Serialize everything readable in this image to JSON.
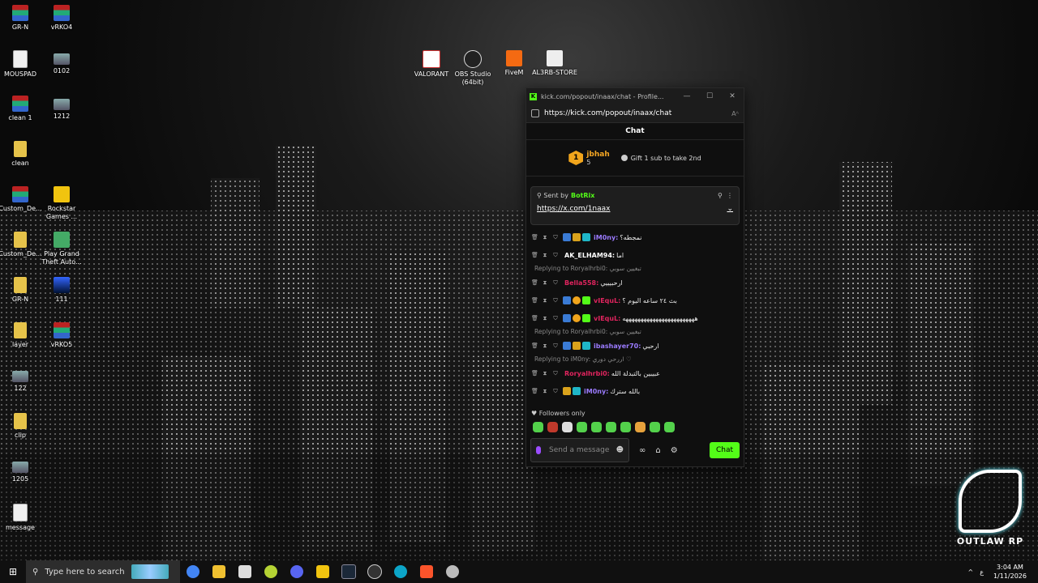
{
  "desktop": {
    "icons": [
      {
        "label": "GR-N"
      },
      {
        "label": "vRKO4"
      },
      {
        "label": "MOUSPAD"
      },
      {
        "label": "0102"
      },
      {
        "label": "clean 1"
      },
      {
        "label": "1212"
      },
      {
        "label": "clean"
      },
      {
        "label": "Custom_De..."
      },
      {
        "label": "Rockstar Games ..."
      },
      {
        "label": "Custom_De..."
      },
      {
        "label": "Play Grand Theft Auto..."
      },
      {
        "label": "GR-N"
      },
      {
        "label": "111"
      },
      {
        "label": "layer"
      },
      {
        "label": "vRKO5"
      },
      {
        "label": "122"
      },
      {
        "label": "clip"
      },
      {
        "label": "1205"
      },
      {
        "label": "message"
      },
      {
        "label": "VALORANT"
      },
      {
        "label": "OBS Studio (64bit)"
      },
      {
        "label": "FiveM"
      },
      {
        "label": "AL3RB-STORE"
      }
    ]
  },
  "window": {
    "title": "kick.com/popout/inaax/chat - Profile...",
    "url": "https://kick.com/popout/inaax/chat",
    "minimize": "—",
    "maximize": "☐",
    "close": "✕",
    "reader": "Aᴬ"
  },
  "chat": {
    "header": "Chat",
    "top_gifter": {
      "rank": "1",
      "name": "jbhah",
      "count": "5",
      "gift_label": "Gift 1 sub to take 2nd"
    },
    "pinned": {
      "sent_by": "Sent by",
      "bot": "BotRix",
      "link": "https://x.com/1naax"
    },
    "messages": [
      {
        "user": "iM0ny:",
        "text": "نمجطه؟",
        "color": "#9b7bff"
      },
      {
        "user": "AK_ELHAM94:",
        "text": "اما",
        "color": "#ffffff"
      },
      {
        "reply": "Replying to Roryalhrbi0: تبغيين سوبي"
      },
      {
        "user": "Bella558:",
        "text": "ارحبيييي",
        "color": "#e0245e"
      },
      {
        "user": "vIEquL:",
        "text": "بث ٢٤ ساعه اليوم ؟",
        "color": "#e0245e"
      },
      {
        "user": "vIEquL:",
        "text": "ههههههههههههههههههههههههه",
        "color": "#e0245e"
      },
      {
        "reply": "Replying to Roryalhrbi0: تبغيين سوبي"
      },
      {
        "user": "ibashayer70:",
        "text": "ارحبي",
        "color": "#9b7bff"
      },
      {
        "reply": "Replying to iM0ny: اررحي دوري ♡"
      },
      {
        "user": "Roryalhrbi0:",
        "text": "عبيبين بالتبدلة الله",
        "color": "#e0245e"
      },
      {
        "user": "iM0ny:",
        "text": "بالله سترك",
        "color": "#9b7bff"
      }
    ],
    "followers_only": "Followers only",
    "input_placeholder": "Send a message",
    "send_label": "Chat"
  },
  "watermark": {
    "text": "OUTLAW RP"
  },
  "taskbar": {
    "search_placeholder": "Type here to search",
    "time": "3:04 AM",
    "date": "1/11/2026",
    "lang": "ع"
  },
  "colors": {
    "kick_green": "#53fc18",
    "gifter_gold": "#f5a623"
  }
}
